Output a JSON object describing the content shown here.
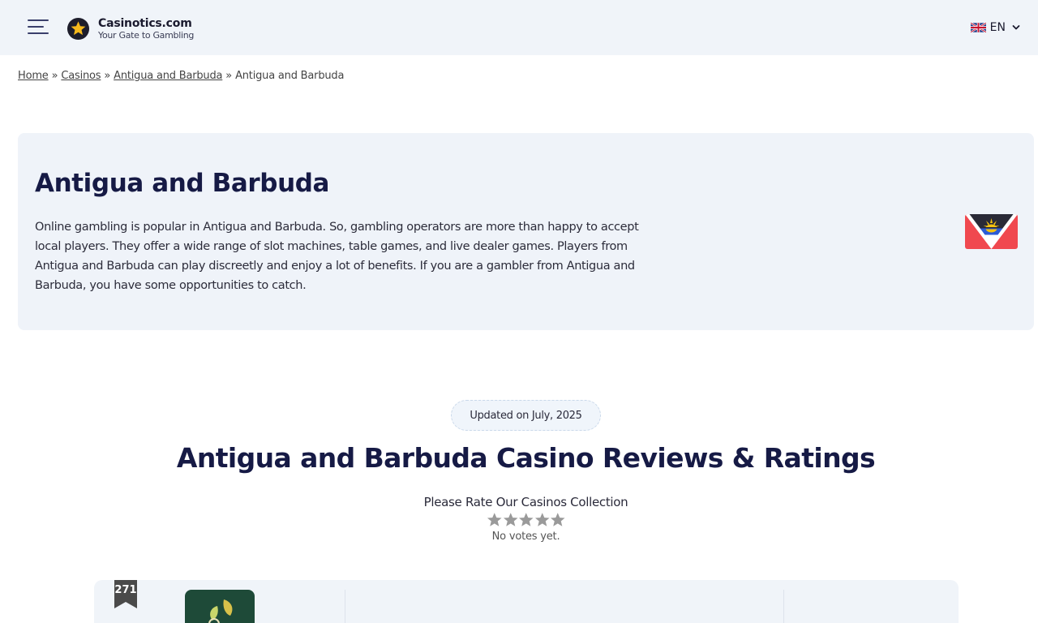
{
  "header": {
    "logo": {
      "name": "Casinotics.com",
      "tagline": "Your Gate to Gambling"
    },
    "language": {
      "code": "EN",
      "flag_icon": "uk-flag-icon"
    },
    "menu_icon": "hamburger-menu-icon"
  },
  "breadcrumb": {
    "items": [
      {
        "label": "Home",
        "link": true
      },
      {
        "label": "Casinos",
        "link": true
      },
      {
        "label": "Antigua and Barbuda",
        "link": true
      },
      {
        "label": "Antigua and Barbuda",
        "link": false
      }
    ],
    "separator": "»"
  },
  "hero": {
    "title": "Antigua and Barbuda",
    "description": "Online gambling is popular in Antigua and Barbuda. So, gambling operators are more than happy to accept local players. They offer a wide range of slot machines, table games, and live dealer games. Players from Antigua and Barbuda can play discreetly and enjoy a lot of benefits. If you are a gambler from Antigua and Barbuda, you have some opportunities to catch.",
    "flag_icon": "antigua-barbuda-flag-icon"
  },
  "updated_badge": "Updated on July, 2025",
  "section": {
    "title": "Antigua and Barbuda Casino Reviews & Ratings",
    "rating_prompt": "Please Rate Our Casinos Collection",
    "rating": {
      "max_stars": 5,
      "filled": 0
    },
    "no_votes": "No votes yet."
  },
  "casino_list": [
    {
      "rank": "271",
      "logo_icon": "leaf-logo-icon"
    }
  ],
  "colors": {
    "header_bg": "#f0f4f9",
    "hero_bg": "#eff3f9",
    "title_color": "#161a45",
    "star_empty": "#9a9a9a"
  }
}
